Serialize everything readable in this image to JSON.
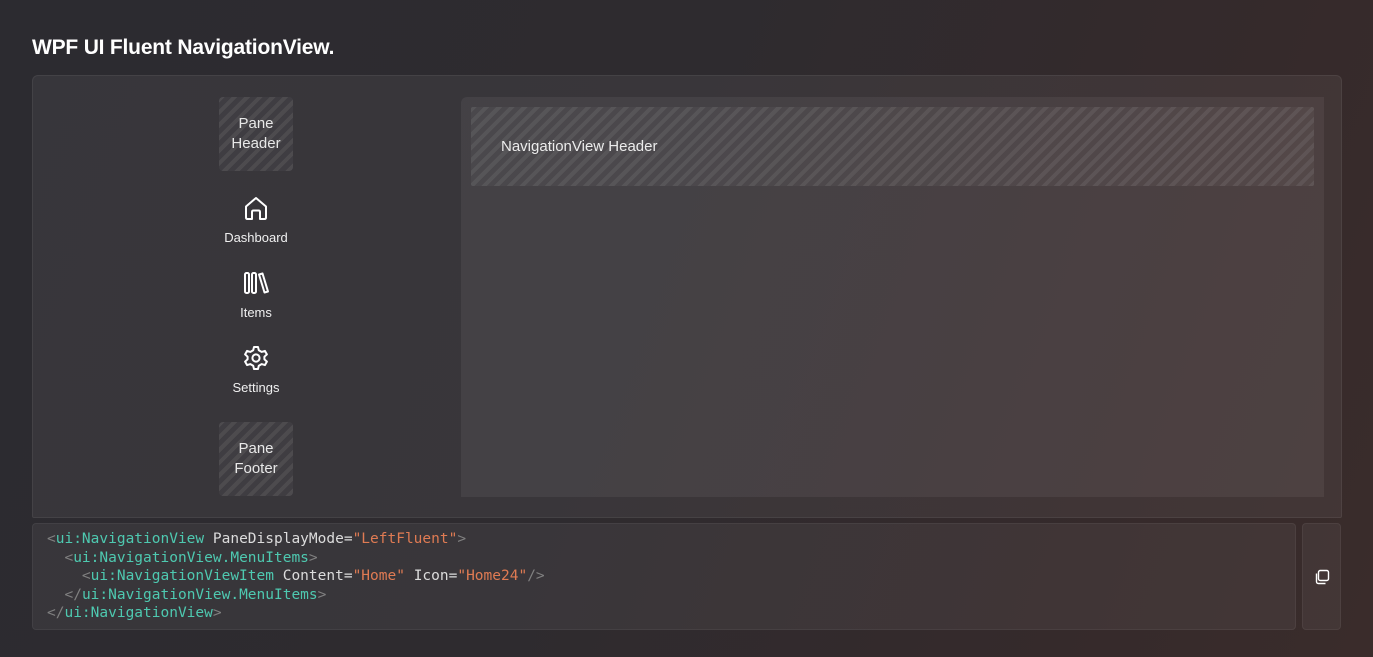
{
  "page": {
    "title": "WPF UI Fluent NavigationView."
  },
  "pane": {
    "header": "Pane Header",
    "footer": "Pane Footer",
    "items": [
      {
        "label": "Dashboard",
        "icon": "home-icon"
      },
      {
        "label": "Items",
        "icon": "library-icon"
      },
      {
        "label": "Settings",
        "icon": "gear-icon"
      }
    ]
  },
  "content": {
    "header": "NavigationView Header"
  },
  "code": {
    "lines": [
      "<ui:NavigationView PaneDisplayMode=\"LeftFluent\">",
      "  <ui:NavigationView.MenuItems>",
      "    <ui:NavigationViewItem Content=\"Home\" Icon=\"Home24\"/>",
      "  </ui:NavigationView.MenuItems>",
      "</ui:NavigationView>"
    ]
  },
  "copy": {
    "icon": "copy-icon"
  },
  "colors": {
    "tag": "#4ec9b0",
    "string": "#e07b53",
    "bracket": "#808080"
  }
}
